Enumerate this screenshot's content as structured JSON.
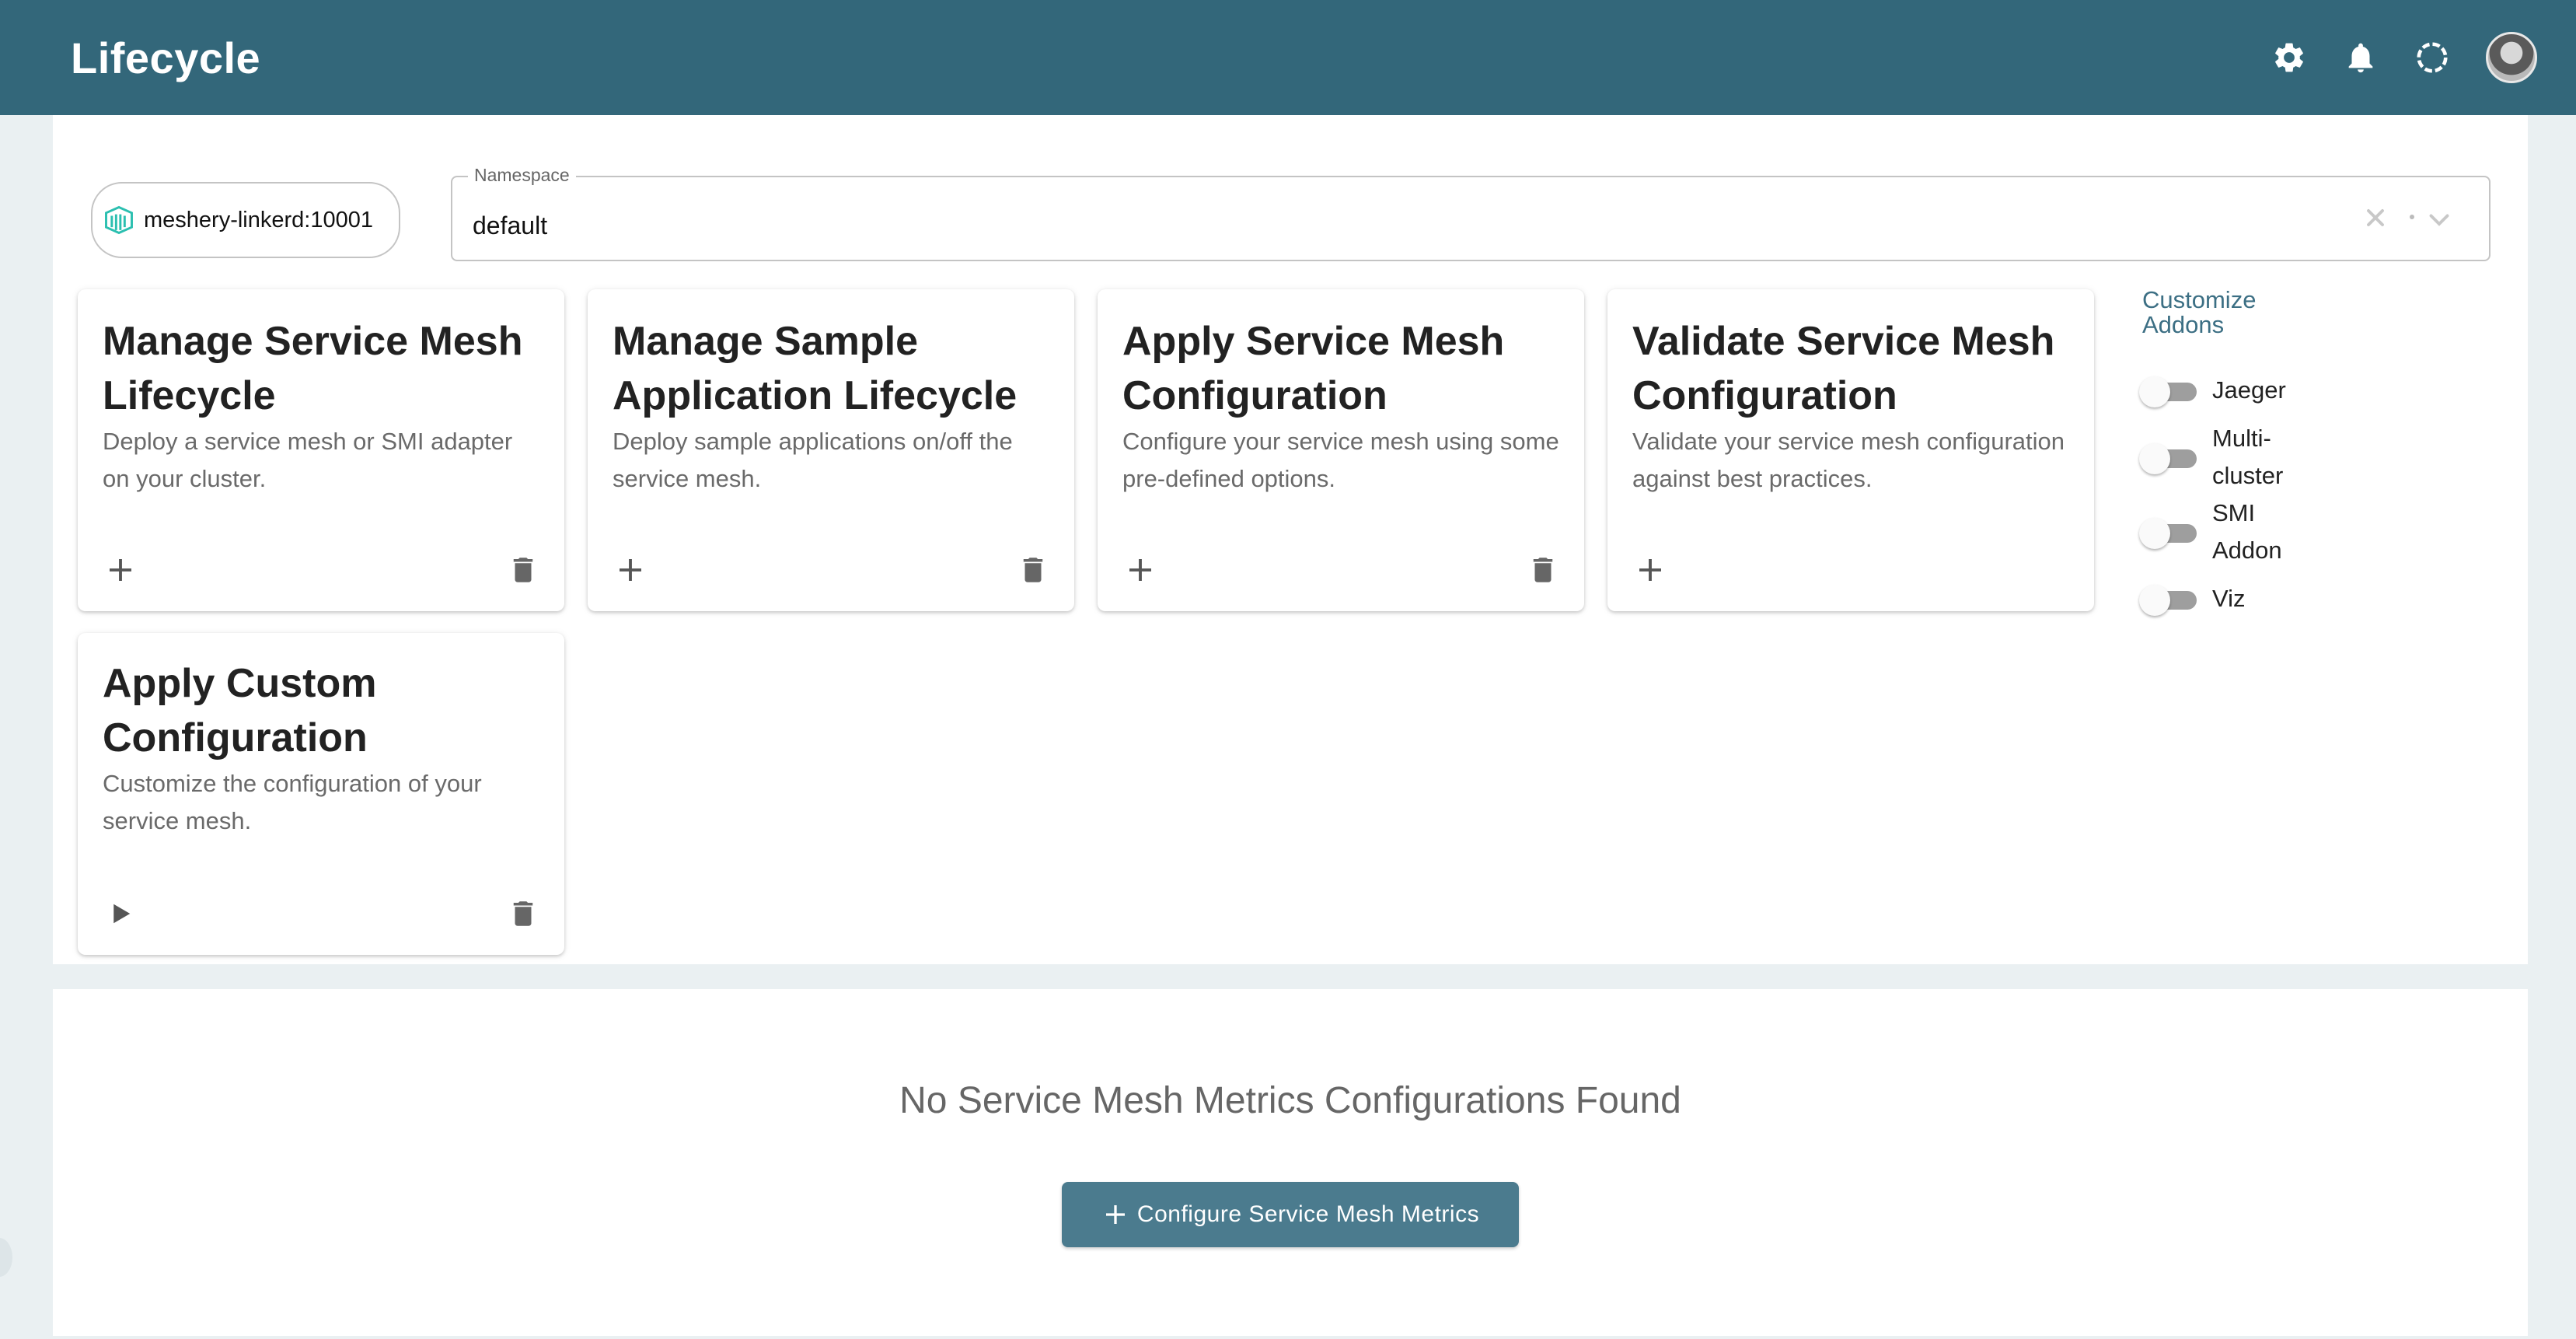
{
  "header": {
    "title": "Lifecycle",
    "icons": [
      "gear-icon",
      "bell-icon",
      "loading-spinner-icon",
      "avatar"
    ]
  },
  "adapter": {
    "label": "meshery-linkerd:10001",
    "icon": "linkerd-logo-icon"
  },
  "namespace": {
    "label": "Namespace",
    "value": "default"
  },
  "cards": [
    {
      "title": "Manage Service Mesh Lifecycle",
      "description": "Deploy a service mesh or SMI adapter on your cluster.",
      "action_icon": "plus-icon",
      "has_delete": true
    },
    {
      "title": "Manage Sample Application Lifecycle",
      "description": "Deploy sample applications on/off the service mesh.",
      "action_icon": "plus-icon",
      "has_delete": true
    },
    {
      "title": "Apply Service Mesh Configuration",
      "description": "Configure your service mesh using some pre-defined options.",
      "action_icon": "plus-icon",
      "has_delete": true
    },
    {
      "title": "Validate Service Mesh Configuration",
      "description": "Validate your service mesh configuration against best practices.",
      "action_icon": "plus-icon",
      "has_delete": false
    },
    {
      "title": "Apply Custom Configuration",
      "description": "Customize the configuration of your service mesh.",
      "action_icon": "play-icon",
      "has_delete": true
    }
  ],
  "addons": {
    "title": "Customize Addons",
    "items": [
      {
        "label": "Jaeger",
        "enabled": false
      },
      {
        "label": "Multi-cluster",
        "enabled": false
      },
      {
        "label": "SMI Addon",
        "enabled": false
      },
      {
        "label": "Viz",
        "enabled": false
      }
    ]
  },
  "metrics": {
    "empty_message": "No Service Mesh Metrics Configurations Found",
    "button_label": "Configure Service Mesh Metrics"
  },
  "colors": {
    "header_bg": "#33677a",
    "accent": "#3c6f84",
    "button_bg": "#4b7b8e"
  }
}
